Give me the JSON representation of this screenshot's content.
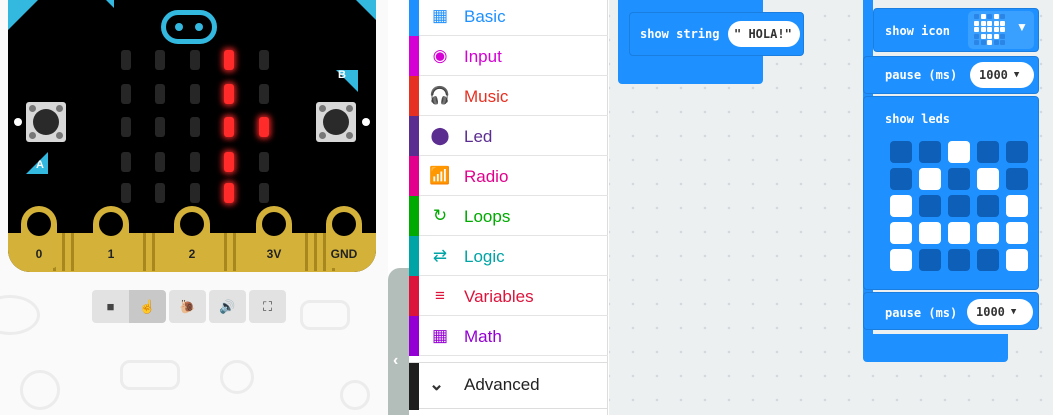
{
  "simulator": {
    "button_a_label": "A",
    "button_b_label": "B",
    "pins": [
      "0",
      "1",
      "2",
      "3V",
      "GND"
    ],
    "led_matrix": [
      [
        0,
        0,
        0,
        1,
        0
      ],
      [
        0,
        0,
        0,
        1,
        0
      ],
      [
        0,
        0,
        0,
        1,
        1
      ],
      [
        0,
        0,
        0,
        1,
        0
      ],
      [
        0,
        0,
        0,
        1,
        0
      ]
    ],
    "controls": [
      {
        "name": "stop-button",
        "icon": "stop-icon",
        "glyph": "■"
      },
      {
        "name": "restart-button",
        "icon": "hand-cursor-icon",
        "glyph": "☝"
      },
      {
        "name": "slow-mo-button",
        "icon": "snail-icon",
        "glyph": "🐌"
      },
      {
        "name": "mute-button",
        "icon": "speaker-icon",
        "glyph": "🔊"
      },
      {
        "name": "fullscreen-button",
        "icon": "fullscreen-icon",
        "glyph": "⛶"
      }
    ]
  },
  "toolbox": {
    "categories": [
      {
        "label": "Basic",
        "color": "#1e90ff",
        "icon": "grid-icon",
        "glyph": "▦"
      },
      {
        "label": "Input",
        "color": "#d400d4",
        "icon": "target-icon",
        "glyph": "◉"
      },
      {
        "label": "Music",
        "color": "#e63022",
        "icon": "headphones-icon",
        "glyph": "🎧"
      },
      {
        "label": "Led",
        "color": "#5c2d91",
        "icon": "toggle-icon",
        "glyph": "⬤"
      },
      {
        "label": "Radio",
        "color": "#e3008c",
        "icon": "signal-icon",
        "glyph": "📶"
      },
      {
        "label": "Loops",
        "color": "#00aa00",
        "icon": "refresh-icon",
        "glyph": "↻"
      },
      {
        "label": "Logic",
        "color": "#00a4a6",
        "icon": "shuffle-icon",
        "glyph": "⇄"
      },
      {
        "label": "Variables",
        "color": "#dc143c",
        "icon": "list-icon",
        "glyph": "≡"
      },
      {
        "label": "Math",
        "color": "#9400d3",
        "icon": "calculator-icon",
        "glyph": "▦"
      }
    ],
    "advanced_label": "Advanced",
    "advanced_icon": "chevron-down-icon",
    "collapse_icon": "chevron-left-icon"
  },
  "workspace": {
    "block_color": "#1e90ff",
    "show_string": {
      "label": "show string",
      "value": "\" HOLA!\""
    },
    "show_icon": {
      "label": "show icon",
      "icon": "heart-icon"
    },
    "pause1": {
      "label": "pause (ms)",
      "value": "1000"
    },
    "show_leds": {
      "label": "show leds",
      "matrix": [
        [
          0,
          0,
          1,
          0,
          0
        ],
        [
          0,
          1,
          0,
          1,
          0
        ],
        [
          1,
          0,
          0,
          0,
          1
        ],
        [
          1,
          1,
          1,
          1,
          1
        ],
        [
          1,
          0,
          0,
          0,
          1
        ]
      ]
    },
    "pause2": {
      "label": "pause (ms)",
      "value": "1000"
    }
  }
}
